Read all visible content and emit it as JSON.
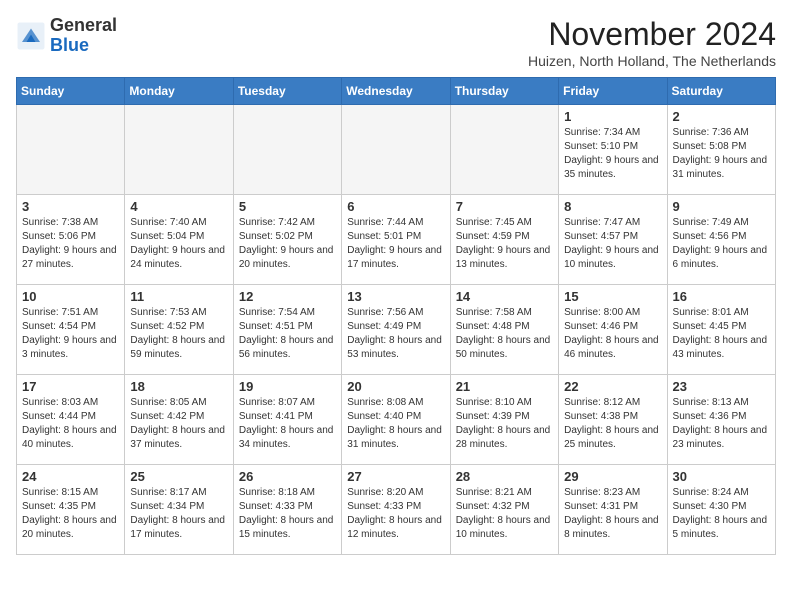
{
  "header": {
    "logo_general": "General",
    "logo_blue": "Blue",
    "title": "November 2024",
    "location": "Huizen, North Holland, The Netherlands"
  },
  "days_of_week": [
    "Sunday",
    "Monday",
    "Tuesday",
    "Wednesday",
    "Thursday",
    "Friday",
    "Saturday"
  ],
  "weeks": [
    [
      {
        "day": "",
        "info": "",
        "empty": true
      },
      {
        "day": "",
        "info": "",
        "empty": true
      },
      {
        "day": "",
        "info": "",
        "empty": true
      },
      {
        "day": "",
        "info": "",
        "empty": true
      },
      {
        "day": "",
        "info": "",
        "empty": true
      },
      {
        "day": "1",
        "info": "Sunrise: 7:34 AM\nSunset: 5:10 PM\nDaylight: 9 hours and 35 minutes.",
        "empty": false
      },
      {
        "day": "2",
        "info": "Sunrise: 7:36 AM\nSunset: 5:08 PM\nDaylight: 9 hours and 31 minutes.",
        "empty": false
      }
    ],
    [
      {
        "day": "3",
        "info": "Sunrise: 7:38 AM\nSunset: 5:06 PM\nDaylight: 9 hours and 27 minutes.",
        "empty": false
      },
      {
        "day": "4",
        "info": "Sunrise: 7:40 AM\nSunset: 5:04 PM\nDaylight: 9 hours and 24 minutes.",
        "empty": false
      },
      {
        "day": "5",
        "info": "Sunrise: 7:42 AM\nSunset: 5:02 PM\nDaylight: 9 hours and 20 minutes.",
        "empty": false
      },
      {
        "day": "6",
        "info": "Sunrise: 7:44 AM\nSunset: 5:01 PM\nDaylight: 9 hours and 17 minutes.",
        "empty": false
      },
      {
        "day": "7",
        "info": "Sunrise: 7:45 AM\nSunset: 4:59 PM\nDaylight: 9 hours and 13 minutes.",
        "empty": false
      },
      {
        "day": "8",
        "info": "Sunrise: 7:47 AM\nSunset: 4:57 PM\nDaylight: 9 hours and 10 minutes.",
        "empty": false
      },
      {
        "day": "9",
        "info": "Sunrise: 7:49 AM\nSunset: 4:56 PM\nDaylight: 9 hours and 6 minutes.",
        "empty": false
      }
    ],
    [
      {
        "day": "10",
        "info": "Sunrise: 7:51 AM\nSunset: 4:54 PM\nDaylight: 9 hours and 3 minutes.",
        "empty": false
      },
      {
        "day": "11",
        "info": "Sunrise: 7:53 AM\nSunset: 4:52 PM\nDaylight: 8 hours and 59 minutes.",
        "empty": false
      },
      {
        "day": "12",
        "info": "Sunrise: 7:54 AM\nSunset: 4:51 PM\nDaylight: 8 hours and 56 minutes.",
        "empty": false
      },
      {
        "day": "13",
        "info": "Sunrise: 7:56 AM\nSunset: 4:49 PM\nDaylight: 8 hours and 53 minutes.",
        "empty": false
      },
      {
        "day": "14",
        "info": "Sunrise: 7:58 AM\nSunset: 4:48 PM\nDaylight: 8 hours and 50 minutes.",
        "empty": false
      },
      {
        "day": "15",
        "info": "Sunrise: 8:00 AM\nSunset: 4:46 PM\nDaylight: 8 hours and 46 minutes.",
        "empty": false
      },
      {
        "day": "16",
        "info": "Sunrise: 8:01 AM\nSunset: 4:45 PM\nDaylight: 8 hours and 43 minutes.",
        "empty": false
      }
    ],
    [
      {
        "day": "17",
        "info": "Sunrise: 8:03 AM\nSunset: 4:44 PM\nDaylight: 8 hours and 40 minutes.",
        "empty": false
      },
      {
        "day": "18",
        "info": "Sunrise: 8:05 AM\nSunset: 4:42 PM\nDaylight: 8 hours and 37 minutes.",
        "empty": false
      },
      {
        "day": "19",
        "info": "Sunrise: 8:07 AM\nSunset: 4:41 PM\nDaylight: 8 hours and 34 minutes.",
        "empty": false
      },
      {
        "day": "20",
        "info": "Sunrise: 8:08 AM\nSunset: 4:40 PM\nDaylight: 8 hours and 31 minutes.",
        "empty": false
      },
      {
        "day": "21",
        "info": "Sunrise: 8:10 AM\nSunset: 4:39 PM\nDaylight: 8 hours and 28 minutes.",
        "empty": false
      },
      {
        "day": "22",
        "info": "Sunrise: 8:12 AM\nSunset: 4:38 PM\nDaylight: 8 hours and 25 minutes.",
        "empty": false
      },
      {
        "day": "23",
        "info": "Sunrise: 8:13 AM\nSunset: 4:36 PM\nDaylight: 8 hours and 23 minutes.",
        "empty": false
      }
    ],
    [
      {
        "day": "24",
        "info": "Sunrise: 8:15 AM\nSunset: 4:35 PM\nDaylight: 8 hours and 20 minutes.",
        "empty": false
      },
      {
        "day": "25",
        "info": "Sunrise: 8:17 AM\nSunset: 4:34 PM\nDaylight: 8 hours and 17 minutes.",
        "empty": false
      },
      {
        "day": "26",
        "info": "Sunrise: 8:18 AM\nSunset: 4:33 PM\nDaylight: 8 hours and 15 minutes.",
        "empty": false
      },
      {
        "day": "27",
        "info": "Sunrise: 8:20 AM\nSunset: 4:33 PM\nDaylight: 8 hours and 12 minutes.",
        "empty": false
      },
      {
        "day": "28",
        "info": "Sunrise: 8:21 AM\nSunset: 4:32 PM\nDaylight: 8 hours and 10 minutes.",
        "empty": false
      },
      {
        "day": "29",
        "info": "Sunrise: 8:23 AM\nSunset: 4:31 PM\nDaylight: 8 hours and 8 minutes.",
        "empty": false
      },
      {
        "day": "30",
        "info": "Sunrise: 8:24 AM\nSunset: 4:30 PM\nDaylight: 8 hours and 5 minutes.",
        "empty": false
      }
    ]
  ]
}
